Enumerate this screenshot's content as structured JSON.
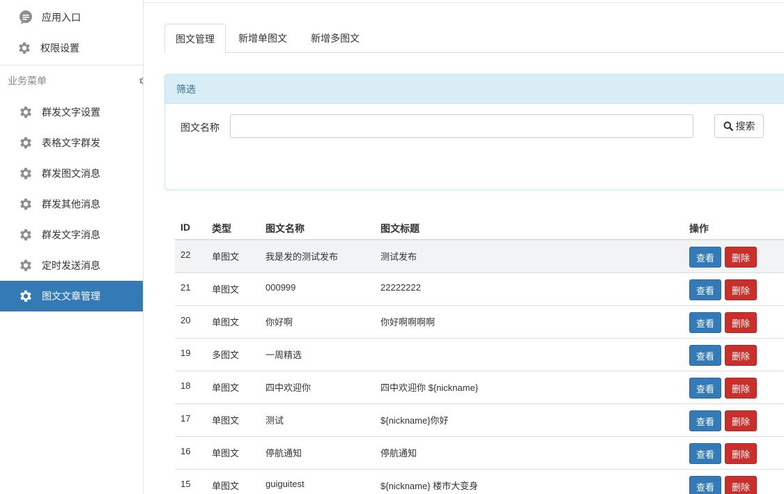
{
  "sidebar": {
    "top_items": [
      {
        "label": "应用入口",
        "icon": "chat-bubble-icon"
      },
      {
        "label": "权限设置",
        "icon": "gear-icon"
      }
    ],
    "section_title": "业务菜单",
    "items": [
      {
        "label": "群发文字设置",
        "icon": "gear-icon"
      },
      {
        "label": "表格文字群发",
        "icon": "gear-icon"
      },
      {
        "label": "群发图文消息",
        "icon": "gear-icon"
      },
      {
        "label": "群发其他消息",
        "icon": "gear-icon"
      },
      {
        "label": "群发文字消息",
        "icon": "gear-icon"
      },
      {
        "label": "定时发送消息",
        "icon": "gear-icon"
      },
      {
        "label": "图文文章管理",
        "icon": "gear-icon",
        "active": true
      }
    ]
  },
  "tabs": [
    {
      "label": "图文管理",
      "active": true
    },
    {
      "label": "新增单图文"
    },
    {
      "label": "新增多图文"
    }
  ],
  "filter": {
    "title": "筛选",
    "name_label": "图文名称",
    "name_value": "",
    "search_label": "搜索"
  },
  "table": {
    "headers": [
      "ID",
      "类型",
      "图文名称",
      "图文标题",
      "操作"
    ],
    "view_label": "查看",
    "delete_label": "删除",
    "rows": [
      {
        "id": "22",
        "type": "单图文",
        "name": "我是发的测试发布",
        "title": "测试发布"
      },
      {
        "id": "21",
        "type": "单图文",
        "name": "000999",
        "title": "22222222"
      },
      {
        "id": "20",
        "type": "单图文",
        "name": "你好啊",
        "title": "你好啊啊啊啊"
      },
      {
        "id": "19",
        "type": "多图文",
        "name": "一周精选",
        "title": ""
      },
      {
        "id": "18",
        "type": "单图文",
        "name": "四中欢迎你",
        "title": "四中欢迎你 ${nickname}"
      },
      {
        "id": "17",
        "type": "单图文",
        "name": "测试",
        "title": "${nickname}你好"
      },
      {
        "id": "16",
        "type": "单图文",
        "name": "停航通知",
        "title": "停航通知"
      },
      {
        "id": "15",
        "type": "单图文",
        "name": "guiguitest",
        "title": "${nickname} 楼市大变身"
      }
    ]
  },
  "colors": {
    "primary": "#337ab7",
    "danger": "#c9302c",
    "panel_head_bg": "#d9edf7",
    "panel_head_text": "#31708f",
    "icon_gray": "#8e8e8e"
  }
}
